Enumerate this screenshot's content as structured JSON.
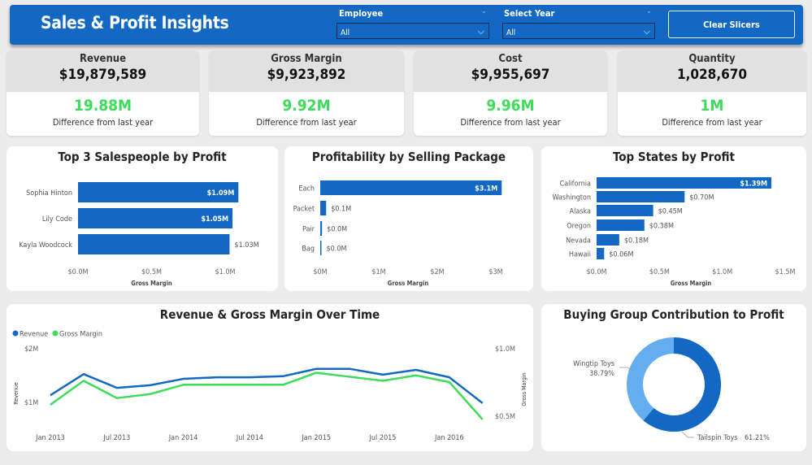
{
  "header": {
    "title": "Sales & Profit Insights",
    "clear_label": "Clear Slicers",
    "slicers": [
      {
        "label": "Employee",
        "value": "All"
      },
      {
        "label": "Select Year",
        "value": "All"
      }
    ]
  },
  "kpis": [
    {
      "label": "Revenue",
      "value": "$19,879,589",
      "change": "19.88M",
      "note": "Difference from last year"
    },
    {
      "label": "Gross Margin",
      "value": "$9,923,892",
      "change": "9.92M",
      "note": "Difference from last year"
    },
    {
      "label": "Cost",
      "value": "$9,955,697",
      "change": "9.96M",
      "note": "Difference from last year"
    },
    {
      "label": "Quantity",
      "value": "1,028,670",
      "change": "1M",
      "note": "Difference from last year"
    }
  ],
  "colors": {
    "primary": "#1268c2",
    "positive": "#3ddc5a",
    "green_line": "#3ddc5a",
    "light_blue": "#64aef0"
  },
  "chart_data": [
    {
      "type": "bar",
      "orientation": "horizontal",
      "title": "Top 3 Salespeople by Profit",
      "xlabel": "Gross Margin",
      "xlim": [
        0,
        1.1
      ],
      "categories": [
        "Sophia Hinton",
        "Lily Code",
        "Kayla Woodcock"
      ],
      "values": [
        1.09,
        1.05,
        1.03
      ],
      "labels": [
        "$1.09M",
        "$1.05M",
        "$1.03M"
      ],
      "ticks": [
        "$0.0M",
        "$0.5M",
        "$1.0M"
      ],
      "tick_values": [
        0,
        0.5,
        1.0
      ]
    },
    {
      "type": "bar",
      "orientation": "horizontal",
      "title": "Profitability by Selling Package",
      "xlabel": "Gross Margin",
      "xlim": [
        0,
        3.1
      ],
      "categories": [
        "Each",
        "Packet",
        "Pair",
        "Bag"
      ],
      "values": [
        3.1,
        0.1,
        0.03,
        0.01
      ],
      "labels": [
        "$3.1M",
        "$0.1M",
        "$0.0M",
        "$0.0M"
      ],
      "ticks": [
        "$0M",
        "$1M",
        "$2M",
        "$3M"
      ],
      "tick_values": [
        0,
        1,
        2,
        3
      ]
    },
    {
      "type": "bar",
      "orientation": "horizontal",
      "title": "Top States by Profit",
      "xlabel": "Gross Margin",
      "xlim": [
        0,
        1.5
      ],
      "categories": [
        "California",
        "Washington",
        "Alaska",
        "Oregon",
        "Nevada",
        "Hawaii"
      ],
      "values": [
        1.39,
        0.7,
        0.45,
        0.38,
        0.18,
        0.06
      ],
      "labels": [
        "$1.39M",
        "$0.70M",
        "$0.45M",
        "$0.38M",
        "$0.18M",
        "$0.06M"
      ],
      "ticks": [
        "$0.0M",
        "$0.5M",
        "$1.0M",
        "$1.5M"
      ],
      "tick_values": [
        0,
        0.5,
        1.0,
        1.5
      ]
    },
    {
      "type": "line",
      "title": "Revenue & Gross Margin Over Time",
      "legend": "top-left",
      "x": [
        "2013-01",
        "2013-04",
        "2013-07",
        "2013-10",
        "2014-01",
        "2014-04",
        "2014-07",
        "2014-10",
        "2015-01",
        "2015-04",
        "2015-07",
        "2015-10",
        "2016-01",
        "2016-04"
      ],
      "xticks": [
        "Jan 2013",
        "Jul 2013",
        "Jan 2014",
        "Jul 2014",
        "Jan 2015",
        "Jul 2015",
        "Jan 2016"
      ],
      "ylabel": "Revenue",
      "y2label": "Gross Margin",
      "yticks": [
        "$2M",
        "$1M"
      ],
      "y2ticks": [
        "$1.0M",
        "$0.5M"
      ],
      "series": [
        {
          "name": "Revenue",
          "axis": "left",
          "unit": "$M",
          "values": [
            1.12,
            1.52,
            1.26,
            1.31,
            1.43,
            1.46,
            1.46,
            1.48,
            1.62,
            1.62,
            1.51,
            1.6,
            1.46,
            0.97
          ]
        },
        {
          "name": "Gross Margin",
          "axis": "right",
          "unit": "$M",
          "values": [
            0.58,
            0.76,
            0.63,
            0.66,
            0.73,
            0.73,
            0.73,
            0.73,
            0.82,
            0.79,
            0.76,
            0.8,
            0.75,
            0.47
          ]
        }
      ]
    },
    {
      "type": "pie",
      "donut": true,
      "title": "Buying Group Contribution to Profit",
      "categories": [
        "Tailspin Toys",
        "Wingtip Toys"
      ],
      "values": [
        61.21,
        38.79
      ],
      "labels": [
        "61.21%",
        "38.79%"
      ]
    }
  ]
}
